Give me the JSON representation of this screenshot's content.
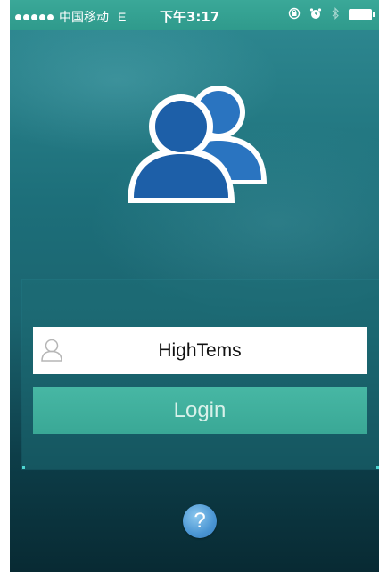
{
  "status_bar": {
    "signal_dots": 5,
    "carrier": "中国移动",
    "network": "E",
    "time": "下午3:17",
    "icons": [
      "rotation-lock-icon",
      "alarm-icon",
      "bluetooth-icon",
      "battery-icon"
    ],
    "background": "#3aa898"
  },
  "logo": {
    "icon": "users-icon",
    "color": "#1d5fa8"
  },
  "login": {
    "username_value": "HighTems",
    "username_icon": "user-icon",
    "button_label": "Login",
    "button_color": "#47b7a4"
  },
  "help": {
    "label": "?",
    "color": "#4a95d3"
  }
}
